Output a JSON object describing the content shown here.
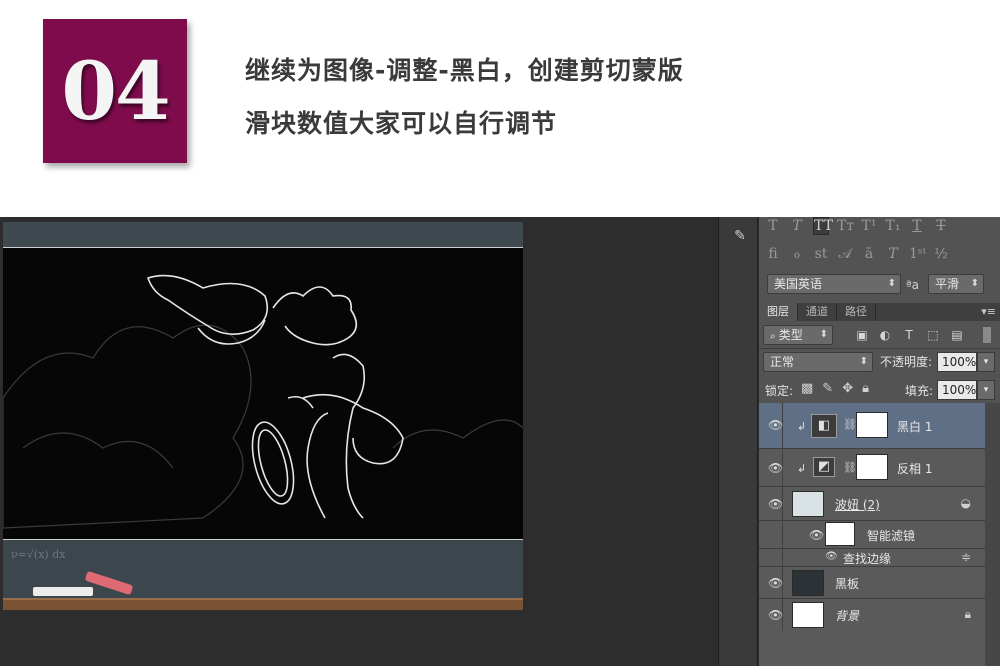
{
  "header": {
    "badge_number": "04",
    "line1": "继续为图像-调整-黑白，创建剪切蒙版",
    "line2": "滑块数值大家可以自行调节"
  },
  "canvas": {
    "chalk_scribble": "ν=√(x)\ndx"
  },
  "panel": {
    "language": "美国英语",
    "aa_label": "ªa",
    "antialias": "平滑",
    "tabs": [
      "图层",
      "通道",
      "路径"
    ],
    "filter_kind": "类型",
    "blend_mode": "正常",
    "opacity_label": "不透明度:",
    "opacity_value": "100%",
    "lock_label": "锁定:",
    "fill_label": "填充:",
    "fill_value": "100%",
    "layers": [
      {
        "name": "黑白 1",
        "selected": true
      },
      {
        "name": "反相 1"
      },
      {
        "name": "波妞 (2)"
      },
      {
        "name": "智能滤镜"
      },
      {
        "name": "查找边缘"
      },
      {
        "name": "黑板"
      },
      {
        "name": "背景"
      }
    ]
  },
  "colors": {
    "badge": "#7e0c4c",
    "selected_layer": "#5e6f86",
    "panel": "#535353"
  }
}
